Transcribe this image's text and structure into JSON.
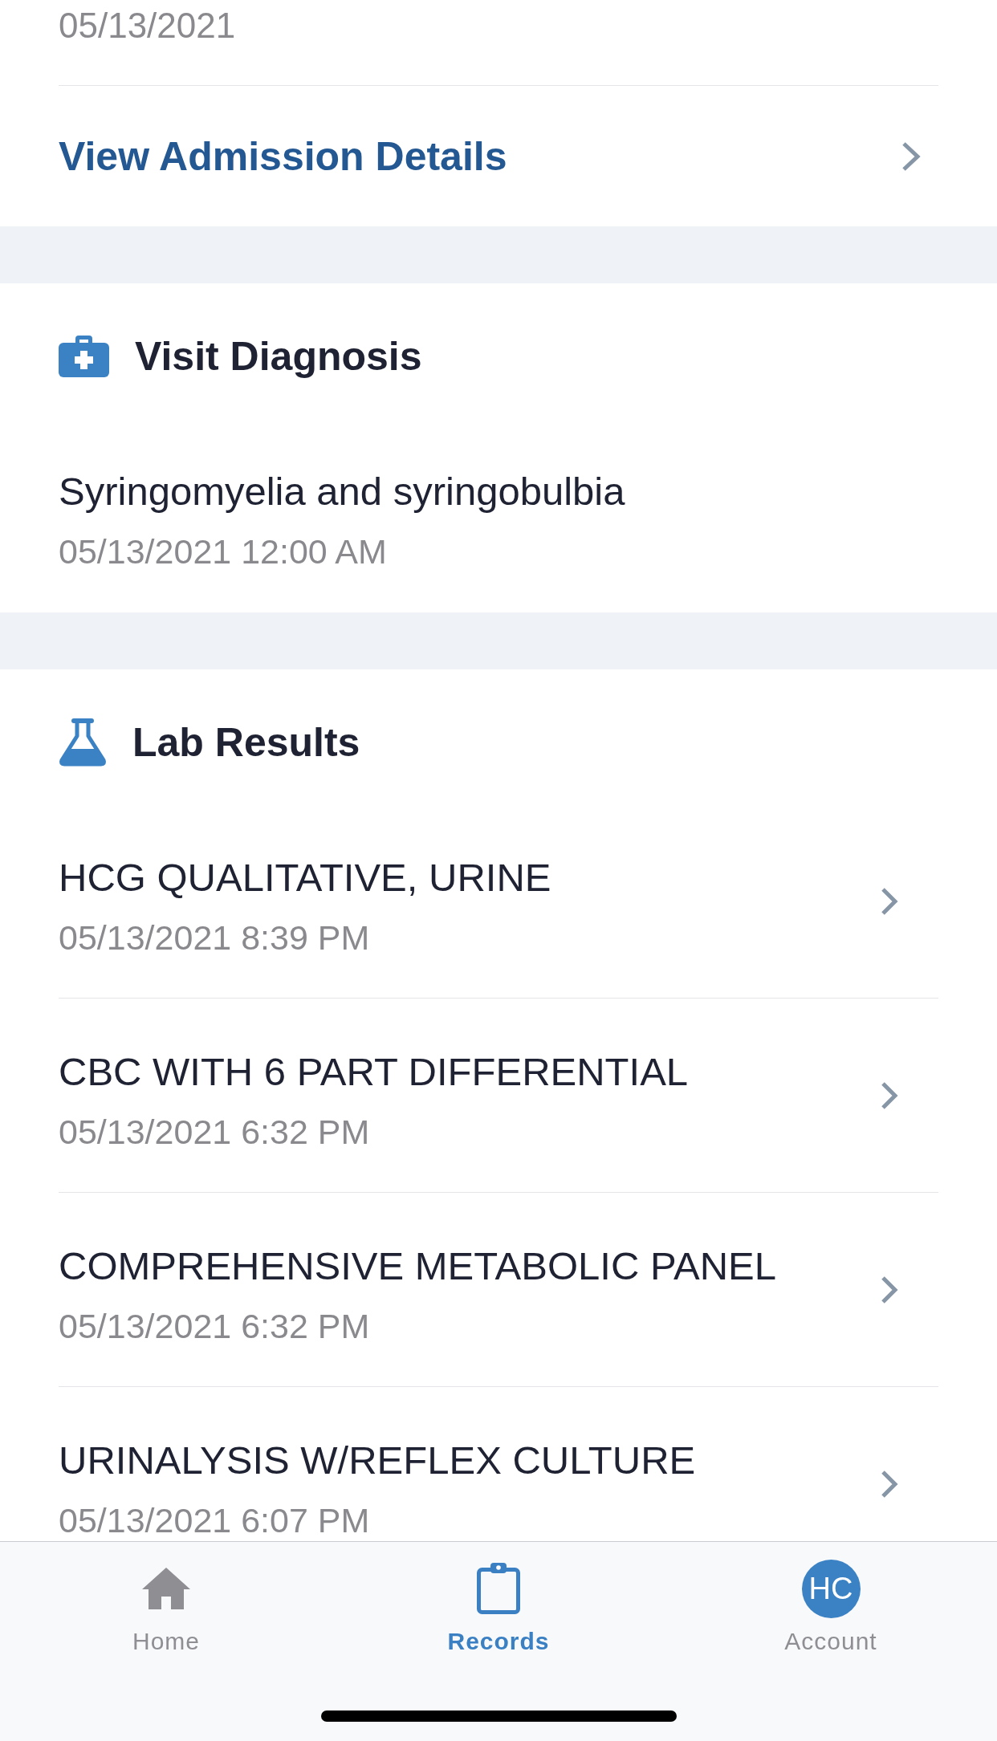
{
  "header": {
    "date": "05/13/2021",
    "link": "View Admission Details"
  },
  "sections": [
    {
      "kind": "diagnosis",
      "title": "Visit Diagnosis",
      "items": [
        {
          "name": "Syringomyelia and syringobulbia",
          "date": "05/13/2021 12:00 AM"
        }
      ]
    },
    {
      "kind": "labs",
      "title": "Lab Results",
      "items": [
        {
          "name": "HCG QUALITATIVE, URINE",
          "date": "05/13/2021 8:39 PM"
        },
        {
          "name": "CBC WITH 6 PART DIFFERENTIAL",
          "date": "05/13/2021 6:32 PM"
        },
        {
          "name": "COMPREHENSIVE METABOLIC PANEL",
          "date": "05/13/2021 6:32 PM"
        },
        {
          "name": "URINALYSIS W/REFLEX CULTURE",
          "date": "05/13/2021 6:07 PM"
        }
      ]
    }
  ],
  "tab_bar": {
    "tabs": [
      {
        "kind": "home",
        "label": "Home",
        "selected": false
      },
      {
        "kind": "records",
        "label": "Records",
        "selected": true
      },
      {
        "kind": "account",
        "label": "Account",
        "initials": "HC",
        "selected": false
      }
    ]
  }
}
